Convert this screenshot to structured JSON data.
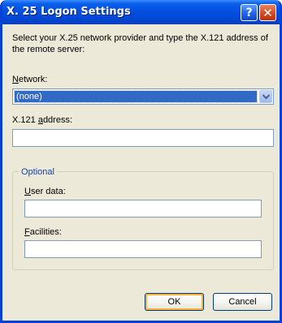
{
  "window": {
    "title": "X. 25 Logon Settings",
    "help_glyph": "?",
    "close_glyph": "✕"
  },
  "instructions": "Select your X.25 network provider and type the X.121 address of the remote server:",
  "network": {
    "label_access": "N",
    "label_rest": "etwork:",
    "selected": "(none)"
  },
  "address": {
    "label_pre": "X.121 ",
    "label_access": "a",
    "label_rest": "ddress:",
    "value": ""
  },
  "optional": {
    "legend": "Optional",
    "user_data": {
      "label_access": "U",
      "label_rest": "ser data:",
      "value": ""
    },
    "facilities": {
      "label_access": "F",
      "label_rest": "acilities:",
      "value": ""
    }
  },
  "buttons": {
    "ok": "OK",
    "cancel": "Cancel"
  },
  "colors": {
    "titlebar": "#0450E0",
    "dialog_bg": "#ECE9D8",
    "selection": "#316AC5",
    "group_legend": "#0046D5"
  },
  "icons": {
    "help": "help-icon",
    "close": "close-icon",
    "dropdown": "chevron-down-icon"
  }
}
